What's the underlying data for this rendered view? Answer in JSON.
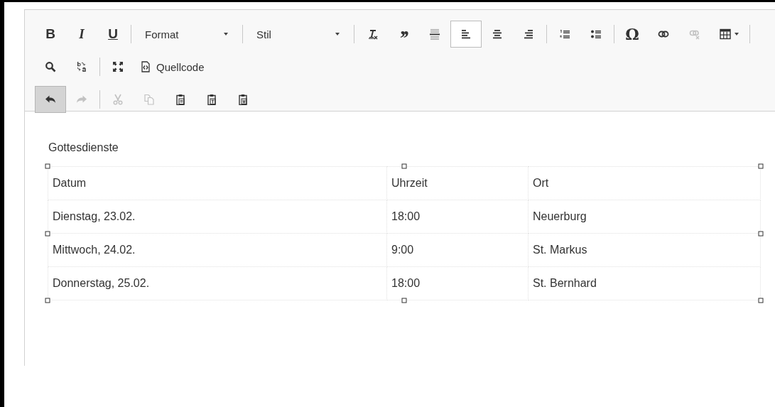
{
  "toolbar": {
    "rows": [
      [
        {
          "kind": "bold",
          "label": "B",
          "disabled": false,
          "selected": false
        },
        {
          "kind": "italic",
          "label": "I",
          "disabled": false,
          "selected": false
        },
        {
          "kind": "underline",
          "label": "U",
          "disabled": false,
          "selected": false
        },
        {
          "kind": "separator"
        },
        {
          "kind": "combo",
          "label": "Format"
        },
        {
          "kind": "separator"
        },
        {
          "kind": "combo",
          "label": "Stil"
        },
        {
          "kind": "separator"
        },
        {
          "kind": "clear-format",
          "disabled": false,
          "selected": false
        },
        {
          "kind": "quote",
          "label": "’’",
          "disabled": false,
          "selected": false
        },
        {
          "kind": "horizontal-rule",
          "disabled": false,
          "selected": false
        },
        {
          "kind": "align-left",
          "disabled": false,
          "selected": true
        },
        {
          "kind": "align-center",
          "disabled": false,
          "selected": false
        },
        {
          "kind": "align-right",
          "disabled": false,
          "selected": false
        },
        {
          "kind": "separator"
        },
        {
          "kind": "numbered-list",
          "disabled": false,
          "selected": false
        },
        {
          "kind": "bullet-list",
          "disabled": false,
          "selected": false
        },
        {
          "kind": "separator"
        },
        {
          "kind": "special-char",
          "label": "Ω",
          "disabled": false,
          "selected": false
        },
        {
          "kind": "link",
          "disabled": false,
          "selected": false
        },
        {
          "kind": "unlink",
          "disabled": true,
          "selected": false
        },
        {
          "kind": "table",
          "disabled": false,
          "selected": false
        },
        {
          "kind": "separator"
        }
      ],
      [
        {
          "kind": "search",
          "disabled": false,
          "selected": false
        },
        {
          "kind": "replace",
          "disabled": false,
          "selected": false
        },
        {
          "kind": "separator"
        },
        {
          "kind": "maximize",
          "disabled": false,
          "selected": false
        },
        {
          "kind": "source",
          "label": "Quellcode",
          "disabled": false,
          "selected": false
        }
      ],
      [
        {
          "kind": "undo",
          "disabled": false,
          "selected": true
        },
        {
          "kind": "redo",
          "disabled": true,
          "selected": false
        },
        {
          "kind": "separator"
        },
        {
          "kind": "cut",
          "disabled": true,
          "selected": false
        },
        {
          "kind": "copy",
          "disabled": true,
          "selected": false
        },
        {
          "kind": "paste",
          "disabled": false,
          "selected": false
        },
        {
          "kind": "paste-text",
          "disabled": false,
          "selected": false
        },
        {
          "kind": "paste-word",
          "disabled": false,
          "selected": false
        }
      ]
    ]
  },
  "content": {
    "heading": "Gottesdienste",
    "table": {
      "selected": true,
      "rows": [
        [
          "Datum",
          "Uhrzeit",
          "Ort"
        ],
        [
          "Dienstag, 23.02.",
          "18:00",
          "Neuerburg"
        ],
        [
          "Mittwoch, 24.02.",
          "9:00",
          "St. Markus"
        ],
        [
          "Donnerstag, 25.02.",
          "18:00",
          "St. Bernhard"
        ]
      ]
    }
  }
}
